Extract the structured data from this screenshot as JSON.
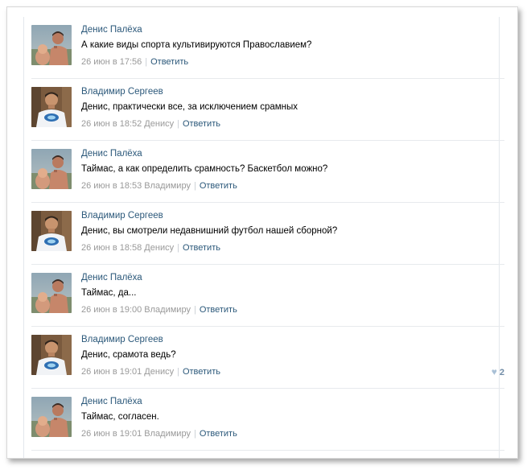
{
  "comments": [
    {
      "author": "Денис Палёха",
      "avatar": "denis",
      "text": "А какие виды спорта культивируются Православием?",
      "date": "26 июн в 17:56",
      "reply_to": "",
      "reply_label": "Ответить",
      "likes": ""
    },
    {
      "author": "Владимир Сергеев",
      "avatar": "vladimir",
      "text": "Денис, практически все, за исключением срамных",
      "date": "26 июн в 18:52",
      "reply_to": "Денису",
      "reply_label": "Ответить",
      "likes": ""
    },
    {
      "author": "Денис Палёха",
      "avatar": "denis",
      "text": "Таймас, а как определить срамность? Баскетбол можно?",
      "date": "26 июн в 18:53",
      "reply_to": "Владимиру",
      "reply_label": "Ответить",
      "likes": ""
    },
    {
      "author": "Владимир Сергеев",
      "avatar": "vladimir",
      "text": "Денис, вы смотрели недавнишний футбол нашей сборной?",
      "date": "26 июн в 18:58",
      "reply_to": "Денису",
      "reply_label": "Ответить",
      "likes": ""
    },
    {
      "author": "Денис Палёха",
      "avatar": "denis",
      "text": "Таймас, да...",
      "date": "26 июн в 19:00",
      "reply_to": "Владимиру",
      "reply_label": "Ответить",
      "likes": ""
    },
    {
      "author": "Владимир Сергеев",
      "avatar": "vladimir",
      "text": "Денис, срамота ведь?",
      "date": "26 июн в 19:01",
      "reply_to": "Денису",
      "reply_label": "Ответить",
      "likes": "2"
    },
    {
      "author": "Денис Палёха",
      "avatar": "denis",
      "text": "Таймас, согласен.",
      "date": "26 июн в 19:01",
      "reply_to": "Владимиру",
      "reply_label": "Ответить",
      "likes": ""
    }
  ],
  "colors": {
    "link": "#2b587a",
    "meta": "#999999",
    "like": "#6f8ba6"
  }
}
